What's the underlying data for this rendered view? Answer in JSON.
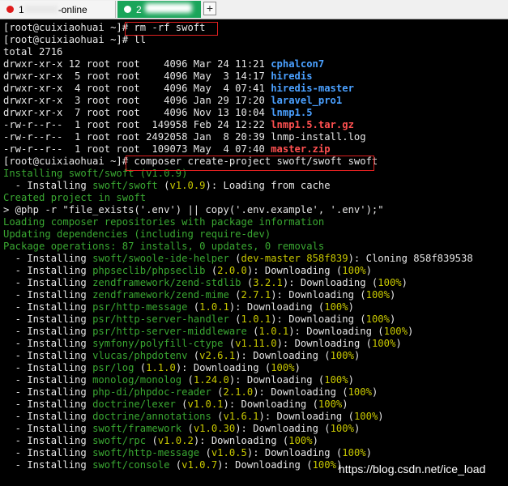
{
  "tabs": [
    {
      "text_prefix": "1",
      "text_suffix": "-online",
      "active": false
    },
    {
      "text_prefix": "2",
      "text_suffix": "",
      "active": true
    }
  ],
  "add_tab_label": "+",
  "terminal": {
    "cmd1": "[root@cuixiaohuai ~]# rm -rf swoft",
    "cmd2": "[root@cuixiaohuai ~]# ll",
    "total": "total 2716",
    "ls": [
      {
        "meta": "drwxr-xr-x 12 root root    4096 Mar 24 11:21 ",
        "name": "cphalcon7",
        "type": "dir"
      },
      {
        "meta": "drwxr-xr-x  5 root root    4096 May  3 14:17 ",
        "name": "hiredis",
        "type": "dir"
      },
      {
        "meta": "drwxr-xr-x  4 root root    4096 May  4 07:41 ",
        "name": "hiredis-master",
        "type": "dir"
      },
      {
        "meta": "drwxr-xr-x  3 root root    4096 Jan 29 17:20 ",
        "name": "laravel_pro1",
        "type": "dir"
      },
      {
        "meta": "drwxr-xr-x  7 root root    4096 Nov 13 10:04 ",
        "name": "lnmp1.5",
        "type": "dir"
      },
      {
        "meta": "-rw-r--r--  1 root root  149958 Feb 24 12:22 ",
        "name": "lnmp1.5.tar.gz",
        "type": "archive"
      },
      {
        "meta": "-rw-r--r--  1 root root 2492058 Jan  8 20:39 ",
        "name": "lnmp-install.log",
        "type": "file"
      },
      {
        "meta": "-rw-r--r--  1 root root  109073 May  4 07:40 ",
        "name": "master.zip",
        "type": "archive"
      }
    ],
    "cmd3": "[root@cuixiaohuai ~]# composer create-project swoft/swoft swoft",
    "installing_swoft": "Installing swoft/swoft (v1.0.9)",
    "loading_cache": {
      "a": "  - Installing ",
      "pkg": "swoft/swoft",
      "b": " (",
      "ver": "v1.0.9",
      "c": "): Loading from cache"
    },
    "created": "Created project in swoft",
    "php_cmd": "> @php -r \"file_exists('.env') || copy('.env.example', '.env');\"",
    "loading_repos": "Loading composer repositories with package information",
    "updating": "Updating dependencies (including require-dev)",
    "package_ops": "Package operations: 87 installs, 0 updates, 0 removals",
    "clone_line": {
      "a": "  - Installing ",
      "pkg": "swoft/swoole-ide-helper",
      "b": " (",
      "ver": "dev-master 858f839",
      "c": "): Cloning 858f839538"
    },
    "installs": [
      {
        "pkg": "phpseclib/phpseclib",
        "ver": "2.0.0"
      },
      {
        "pkg": "zendframework/zend-stdlib",
        "ver": "3.2.1"
      },
      {
        "pkg": "zendframework/zend-mime",
        "ver": "2.7.1"
      },
      {
        "pkg": "psr/http-message",
        "ver": "1.0.1"
      },
      {
        "pkg": "psr/http-server-handler",
        "ver": "1.0.1"
      },
      {
        "pkg": "psr/http-server-middleware",
        "ver": "1.0.1"
      },
      {
        "pkg": "symfony/polyfill-ctype",
        "ver": "v1.11.0"
      },
      {
        "pkg": "vlucas/phpdotenv",
        "ver": "v2.6.1"
      },
      {
        "pkg": "psr/log",
        "ver": "1.1.0"
      },
      {
        "pkg": "monolog/monolog",
        "ver": "1.24.0"
      },
      {
        "pkg": "php-di/phpdoc-reader",
        "ver": "2.1.0"
      },
      {
        "pkg": "doctrine/lexer",
        "ver": "v1.0.1"
      },
      {
        "pkg": "doctrine/annotations",
        "ver": "v1.6.1"
      },
      {
        "pkg": "swoft/framework",
        "ver": "v1.0.30"
      },
      {
        "pkg": "swoft/rpc",
        "ver": "v1.0.2"
      },
      {
        "pkg": "swoft/http-message",
        "ver": "v1.0.5"
      },
      {
        "pkg": "swoft/console",
        "ver": "v1.0.7"
      }
    ],
    "install_prefix": "  - Installing ",
    "downloading": "): Downloading (",
    "percent": "100%",
    "close": ")"
  },
  "watermark": "https://blog.csdn.net/ice_load"
}
